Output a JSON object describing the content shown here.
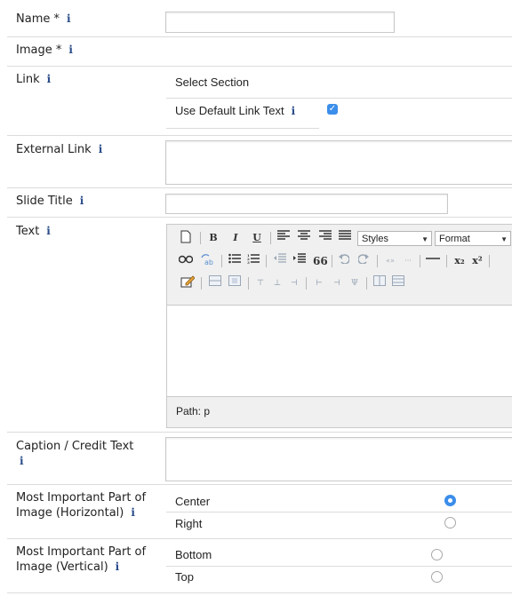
{
  "fields": {
    "name": {
      "label": "Name *",
      "info": "i",
      "value": ""
    },
    "image": {
      "label": "Image *",
      "info": "i"
    },
    "link": {
      "label": "Link",
      "info": "i",
      "select_section": "Select Section",
      "use_default_label": "Use Default Link Text",
      "use_default_info": "i",
      "use_default_checked": true
    },
    "external_link": {
      "label": "External Link",
      "info": "i",
      "value": ""
    },
    "slide_title": {
      "label": "Slide Title",
      "info": "i",
      "value": ""
    },
    "text": {
      "label": "Text",
      "info": "i",
      "toolbar": {
        "bold": "B",
        "italic": "I",
        "underline": "U",
        "styles": "Styles",
        "format": "Format",
        "subscript": "x₂",
        "superscript": "x²",
        "blockquote": "66"
      },
      "path_label": "Path: p"
    },
    "caption": {
      "label_line1": "Caption / Credit Text",
      "info": "i",
      "value": ""
    },
    "focus_horizontal": {
      "label_line1": "Most Important Part of",
      "label_line2": "Image (Horizontal)",
      "info": "i",
      "options": [
        {
          "label": "Center",
          "selected": true
        },
        {
          "label": "Right",
          "selected": false
        }
      ]
    },
    "focus_vertical": {
      "label_line1": "Most Important Part of",
      "label_line2": "Image (Vertical)",
      "info": "i",
      "options": [
        {
          "label": "Bottom",
          "selected": false
        },
        {
          "label": "Top",
          "selected": false
        }
      ]
    }
  },
  "colors": {
    "accent": "#3b8eea",
    "info": "#2a4c8a",
    "divider": "#dcdcdc"
  }
}
